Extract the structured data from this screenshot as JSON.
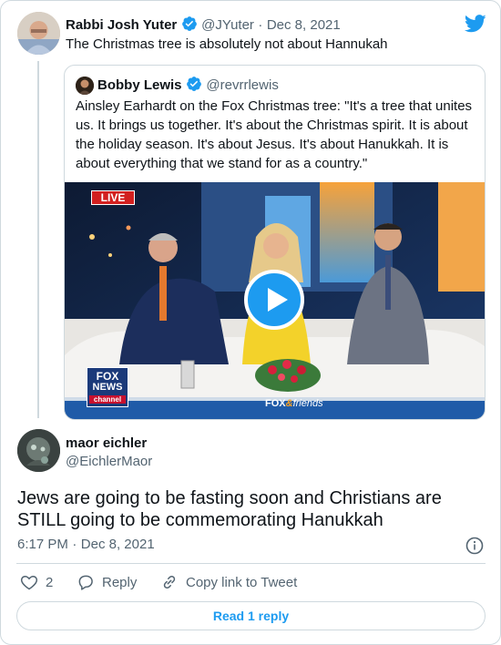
{
  "tweet": {
    "author_name": "Rabbi Josh Yuter",
    "author_handle": "@JYuter",
    "separator": "·",
    "date": "Dec 8, 2021",
    "text": "The Christmas tree is absolutely not about Hannukah"
  },
  "quoted": {
    "author_name": "Bobby Lewis",
    "author_handle": "@revrrlewis",
    "text": "Ainsley Earhardt on the Fox Christmas tree: \"It's a tree that unites us. It brings us together. It's about the Christmas spirit. It is about the holiday season. It's about Jesus. It's about Hanukkah. It is about everything that we stand for as a country.\"",
    "video": {
      "live_badge": "LIVE",
      "network_logo_top": "FOX",
      "network_logo_mid": "NEWS",
      "network_logo_bottom": "channel",
      "show_name_a": "FOX",
      "show_name_b": "friends",
      "show_ampersand": "&"
    }
  },
  "reply": {
    "author_name": "maor eichler",
    "author_handle": "@EichlerMaor",
    "text": "Jews are going to be fasting soon and Christians are STILL going to be commemorating Hanukkah",
    "time": "6:17 PM",
    "separator": "·",
    "date": "Dec 8, 2021",
    "likes_count": "2",
    "reply_label": "Reply",
    "copy_link_label": "Copy link to Tweet",
    "read_replies_label": "Read 1 reply"
  },
  "colors": {
    "twitter_blue": "#1d9bf0",
    "verified_blue": "#1d9bf0",
    "muted_text": "#536471",
    "border": "#cfd9de"
  }
}
